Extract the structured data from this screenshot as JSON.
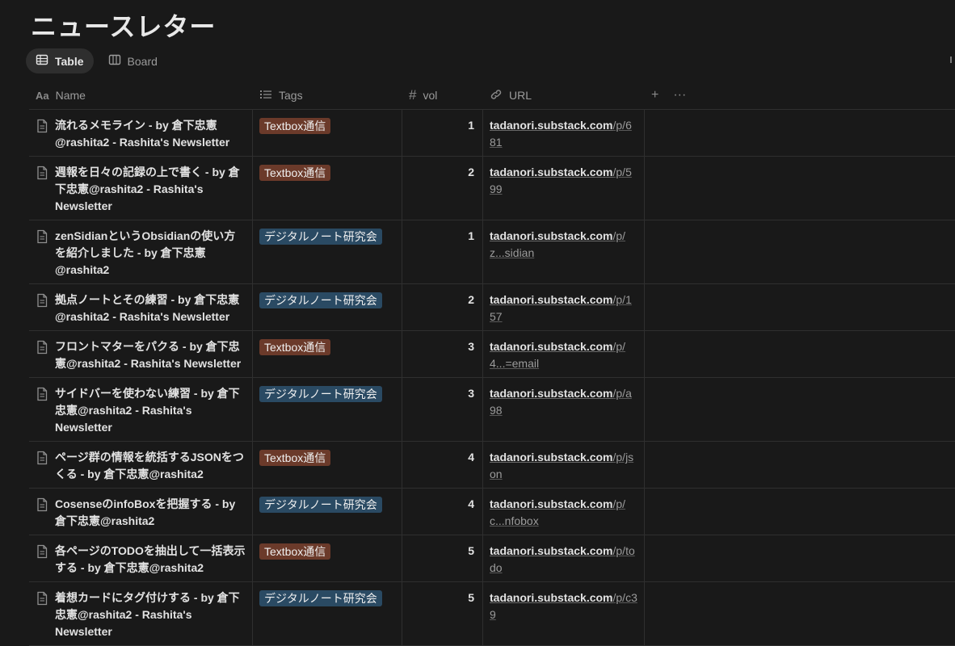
{
  "page": {
    "title": "ニュースレター"
  },
  "views": [
    {
      "label": "Table",
      "icon": "table-icon",
      "active": true
    },
    {
      "label": "Board",
      "icon": "board-icon",
      "active": false
    }
  ],
  "columns": {
    "name": "Name",
    "tags": "Tags",
    "vol": "vol",
    "url": "URL",
    "add": "+",
    "more": "···"
  },
  "colors": {
    "Textbox通信": "#6b3a2a",
    "デジタルノート研究会": "#2a4a63"
  },
  "rows": [
    {
      "name": "流れるメモライン - by 倉下忠憲@rashita2 - Rashita's Newsletter",
      "tag": "Textbox通信",
      "tag_color": "#6b3a2a",
      "vol": "1",
      "url_a": "tadanori.substack.com",
      "url_b": "/p/681"
    },
    {
      "name": "週報を日々の記録の上で書く - by 倉下忠憲@rashita2 - Rashita's Newsletter",
      "tag": "Textbox通信",
      "tag_color": "#6b3a2a",
      "vol": "2",
      "url_a": "tadanori.substack.com",
      "url_b": "/p/599"
    },
    {
      "name": "zenSidianというObsidianの使い方を紹介しました - by 倉下忠憲@rashita2",
      "tag": "デジタルノート研究会",
      "tag_color": "#2a4a63",
      "vol": "1",
      "url_a": "tadanori.substack.com",
      "url_b": "/p/z...sidian"
    },
    {
      "name": "拠点ノートとその練習 - by 倉下忠憲@rashita2 - Rashita's Newsletter",
      "tag": "デジタルノート研究会",
      "tag_color": "#2a4a63",
      "vol": "2",
      "url_a": "tadanori.substack.com",
      "url_b": "/p/157"
    },
    {
      "name": "フロントマターをパクる - by 倉下忠憲@rashita2 - Rashita's Newsletter",
      "tag": "Textbox通信",
      "tag_color": "#6b3a2a",
      "vol": "3",
      "url_a": "tadanori.substack.com",
      "url_b": "/p/4...=email"
    },
    {
      "name": "サイドバーを使わない練習 - by 倉下忠憲@rashita2 - Rashita's Newsletter",
      "tag": "デジタルノート研究会",
      "tag_color": "#2a4a63",
      "vol": "3",
      "url_a": "tadanori.substack.com",
      "url_b": "/p/a98"
    },
    {
      "name": "ページ群の情報を統括するJSONをつくる - by 倉下忠憲@rashita2",
      "tag": "Textbox通信",
      "tag_color": "#6b3a2a",
      "vol": "4",
      "url_a": "tadanori.substack.com",
      "url_b": "/p/json"
    },
    {
      "name": "CosenseのinfoBoxを把握する - by 倉下忠憲@rashita2",
      "tag": "デジタルノート研究会",
      "tag_color": "#2a4a63",
      "vol": "4",
      "url_a": "tadanori.substack.com",
      "url_b": "/p/c...nfobox"
    },
    {
      "name": "各ページのTODOを抽出して一括表示する - by 倉下忠憲@rashita2",
      "tag": "Textbox通信",
      "tag_color": "#6b3a2a",
      "vol": "5",
      "url_a": "tadanori.substack.com",
      "url_b": "/p/todo"
    },
    {
      "name": "着想カードにタグ付けする - by 倉下忠憲@rashita2 - Rashita's Newsletter",
      "tag": "デジタルノート研究会",
      "tag_color": "#2a4a63",
      "vol": "5",
      "url_a": "tadanori.substack.com",
      "url_b": "/p/c39"
    }
  ]
}
